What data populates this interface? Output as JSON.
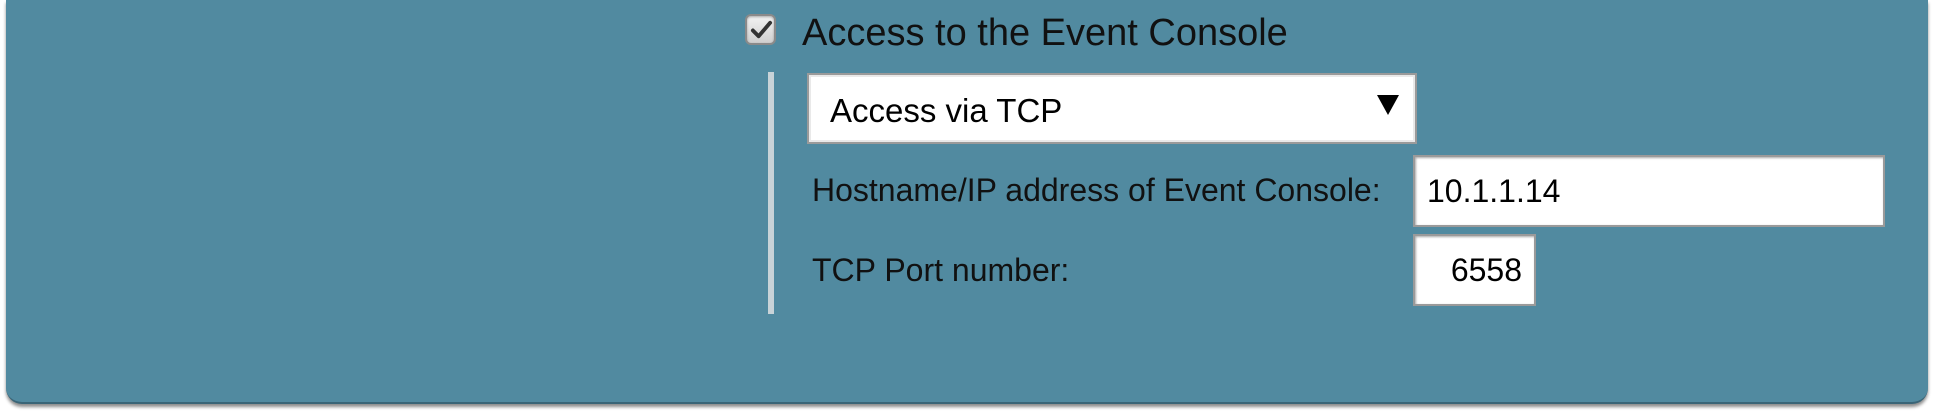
{
  "event_console": {
    "checkbox_checked": true,
    "checkbox_label": "Access to the Event Console",
    "access_method": {
      "selected": "Access via TCP",
      "icon": "triangle-down-icon"
    },
    "hostname": {
      "label": "Hostname/IP address of Event Console:",
      "value": "10.1.1.14"
    },
    "port": {
      "label": "TCP Port number:",
      "value": "6558"
    }
  },
  "colors": {
    "panel_background": "#518aa0",
    "field_background": "#ffffff",
    "text": "#111111"
  }
}
